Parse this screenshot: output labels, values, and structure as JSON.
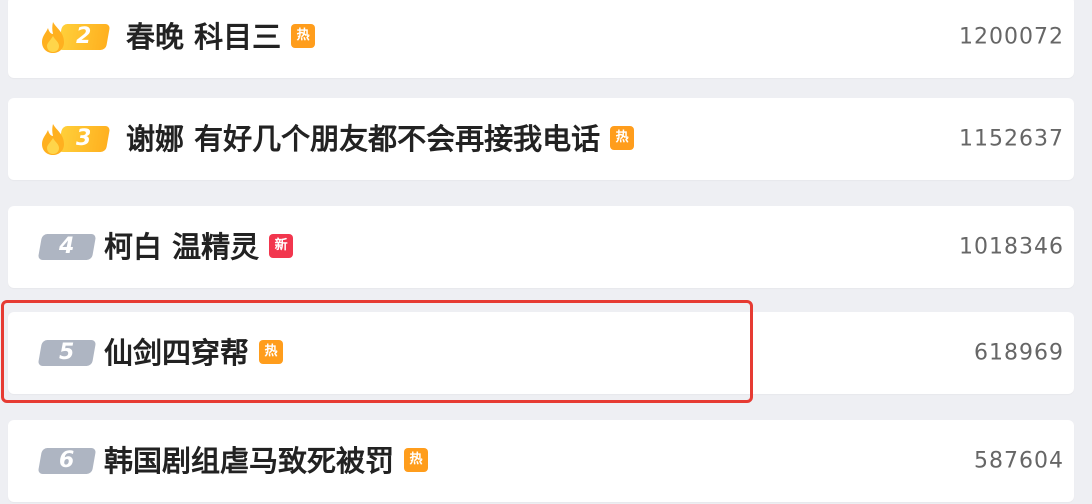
{
  "hot_search": {
    "items": [
      {
        "rank": "2",
        "title": "春晚 科目三",
        "tag": "热",
        "tag_type": "hot",
        "count": "1200072"
      },
      {
        "rank": "3",
        "title": "谢娜 有好几个朋友都不会再接我电话",
        "tag": "热",
        "tag_type": "hot",
        "count": "1152637"
      },
      {
        "rank": "4",
        "title": "柯白 温精灵",
        "tag": "新",
        "tag_type": "new",
        "count": "1018346"
      },
      {
        "rank": "5",
        "title": "仙剑四穿帮",
        "tag": "热",
        "tag_type": "hot",
        "count": "618969"
      },
      {
        "rank": "6",
        "title": "韩国剧组虐马致死被罚",
        "tag": "热",
        "tag_type": "hot",
        "count": "587604"
      }
    ]
  },
  "colors": {
    "hot_rank": "#ffb01f",
    "plain_rank": "#aeb5c2",
    "hot_tag": "#ff9d1c",
    "new_tag": "#f2364e",
    "highlight": "#e63b33"
  },
  "icons": {
    "flame": "flame-icon",
    "hot_tag": "hot-tag-icon",
    "new_tag": "new-tag-icon"
  }
}
